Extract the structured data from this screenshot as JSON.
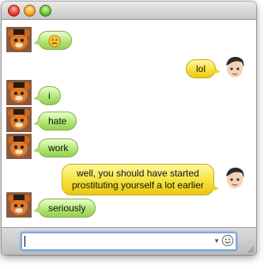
{
  "window": {
    "traffic_lights": [
      "close-button",
      "minimize-button",
      "zoom-button"
    ]
  },
  "messages": [
    {
      "sender": "other",
      "text": "",
      "emoticon": "frown"
    },
    {
      "sender": "self",
      "text": "lol"
    },
    {
      "sender": "other",
      "text": "i"
    },
    {
      "sender": "other",
      "text": "hate"
    },
    {
      "sender": "other",
      "text": "work"
    },
    {
      "sender": "self",
      "line1": "well, you should have started",
      "line2": "prostituting yourself a lot earlier"
    },
    {
      "sender": "other",
      "text": "seriously"
    }
  ],
  "input": {
    "value": "",
    "placeholder": ""
  },
  "colors": {
    "incoming_bubble": "#b4e67a",
    "outgoing_bubble": "#f6e23a",
    "focus_ring": "#7ea7e0"
  }
}
